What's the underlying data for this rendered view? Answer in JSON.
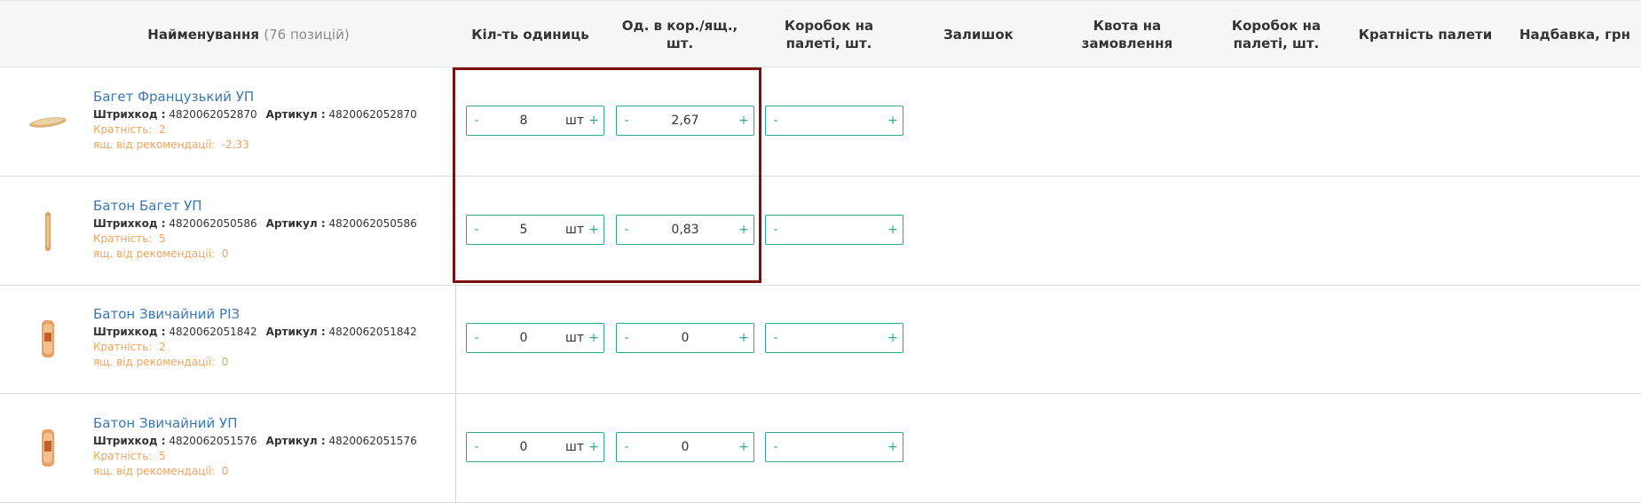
{
  "header": {
    "name_label": "Найменування",
    "name_count": "(76 позицій)",
    "col_units": "Кіл-ть одиниць",
    "col_per_box": "Од. в кор./ящ., шт.",
    "col_boxes_pallet_1": "Коробок на палеті, шт.",
    "col_stock": "Залишок",
    "col_quota": "Квота на замовлення",
    "col_boxes_pallet_2": "Коробок на палеті, шт.",
    "col_pallet_mult": "Кратність палети",
    "col_markup": "Надбавка, грн"
  },
  "labels": {
    "barcode": "Штрихкод :",
    "article": "Артикул :",
    "multiplicity": "Кратність:",
    "rec": "ящ. від рекомендації:",
    "minus": "-",
    "plus": "+",
    "unit": "шт"
  },
  "products": [
    {
      "name": "Багет Французький УП",
      "barcode": "4820062052870",
      "article": "4820062052870",
      "multiplicity": "2",
      "rec": "-2.33",
      "units": "8",
      "per_box": "2,67",
      "boxes": ""
    },
    {
      "name": "Батон Багет УП",
      "barcode": "4820062050586",
      "article": "4820062050586",
      "multiplicity": "5",
      "rec": "0",
      "units": "5",
      "per_box": "0,83",
      "boxes": ""
    },
    {
      "name": "Батон Звичайний РІЗ",
      "barcode": "4820062051842",
      "article": "4820062051842",
      "multiplicity": "2",
      "rec": "0",
      "units": "0",
      "per_box": "0",
      "boxes": ""
    },
    {
      "name": "Батон Звичайний УП",
      "barcode": "4820062051576",
      "article": "4820062051576",
      "multiplicity": "5",
      "rec": "0",
      "units": "0",
      "per_box": "0",
      "boxes": ""
    }
  ],
  "colors": {
    "accent": "#2fa892",
    "link": "#3a78b5",
    "orange": "#f3a35a",
    "highlight": "#7a1010"
  }
}
